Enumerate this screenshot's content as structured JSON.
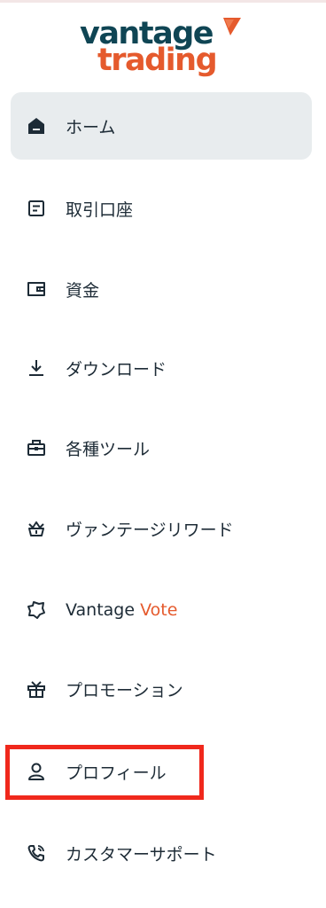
{
  "brand": {
    "line1": "vantage",
    "line2": "trading",
    "primary_color": "#0f4554",
    "accent_color": "#e55a2d"
  },
  "nav": {
    "items": [
      {
        "label": "ホーム",
        "icon": "home-icon",
        "active": true
      },
      {
        "label": "取引口座",
        "icon": "account-icon"
      },
      {
        "label": "資金",
        "icon": "wallet-icon"
      },
      {
        "label": "ダウンロード",
        "icon": "download-icon"
      },
      {
        "label": "各種ツール",
        "icon": "toolbox-icon"
      },
      {
        "label": "ヴァンテージリワード",
        "icon": "crown-basket-icon"
      },
      {
        "label": "Vantage",
        "label_accent": "Vote",
        "icon": "vote-badge-icon"
      },
      {
        "label": "プロモーション",
        "icon": "gift-icon"
      },
      {
        "label": "プロフィール",
        "icon": "user-icon",
        "highlighted": true
      },
      {
        "label": "カスタマーサポート",
        "icon": "phone-icon"
      }
    ]
  },
  "highlight_color": "#f0281c"
}
